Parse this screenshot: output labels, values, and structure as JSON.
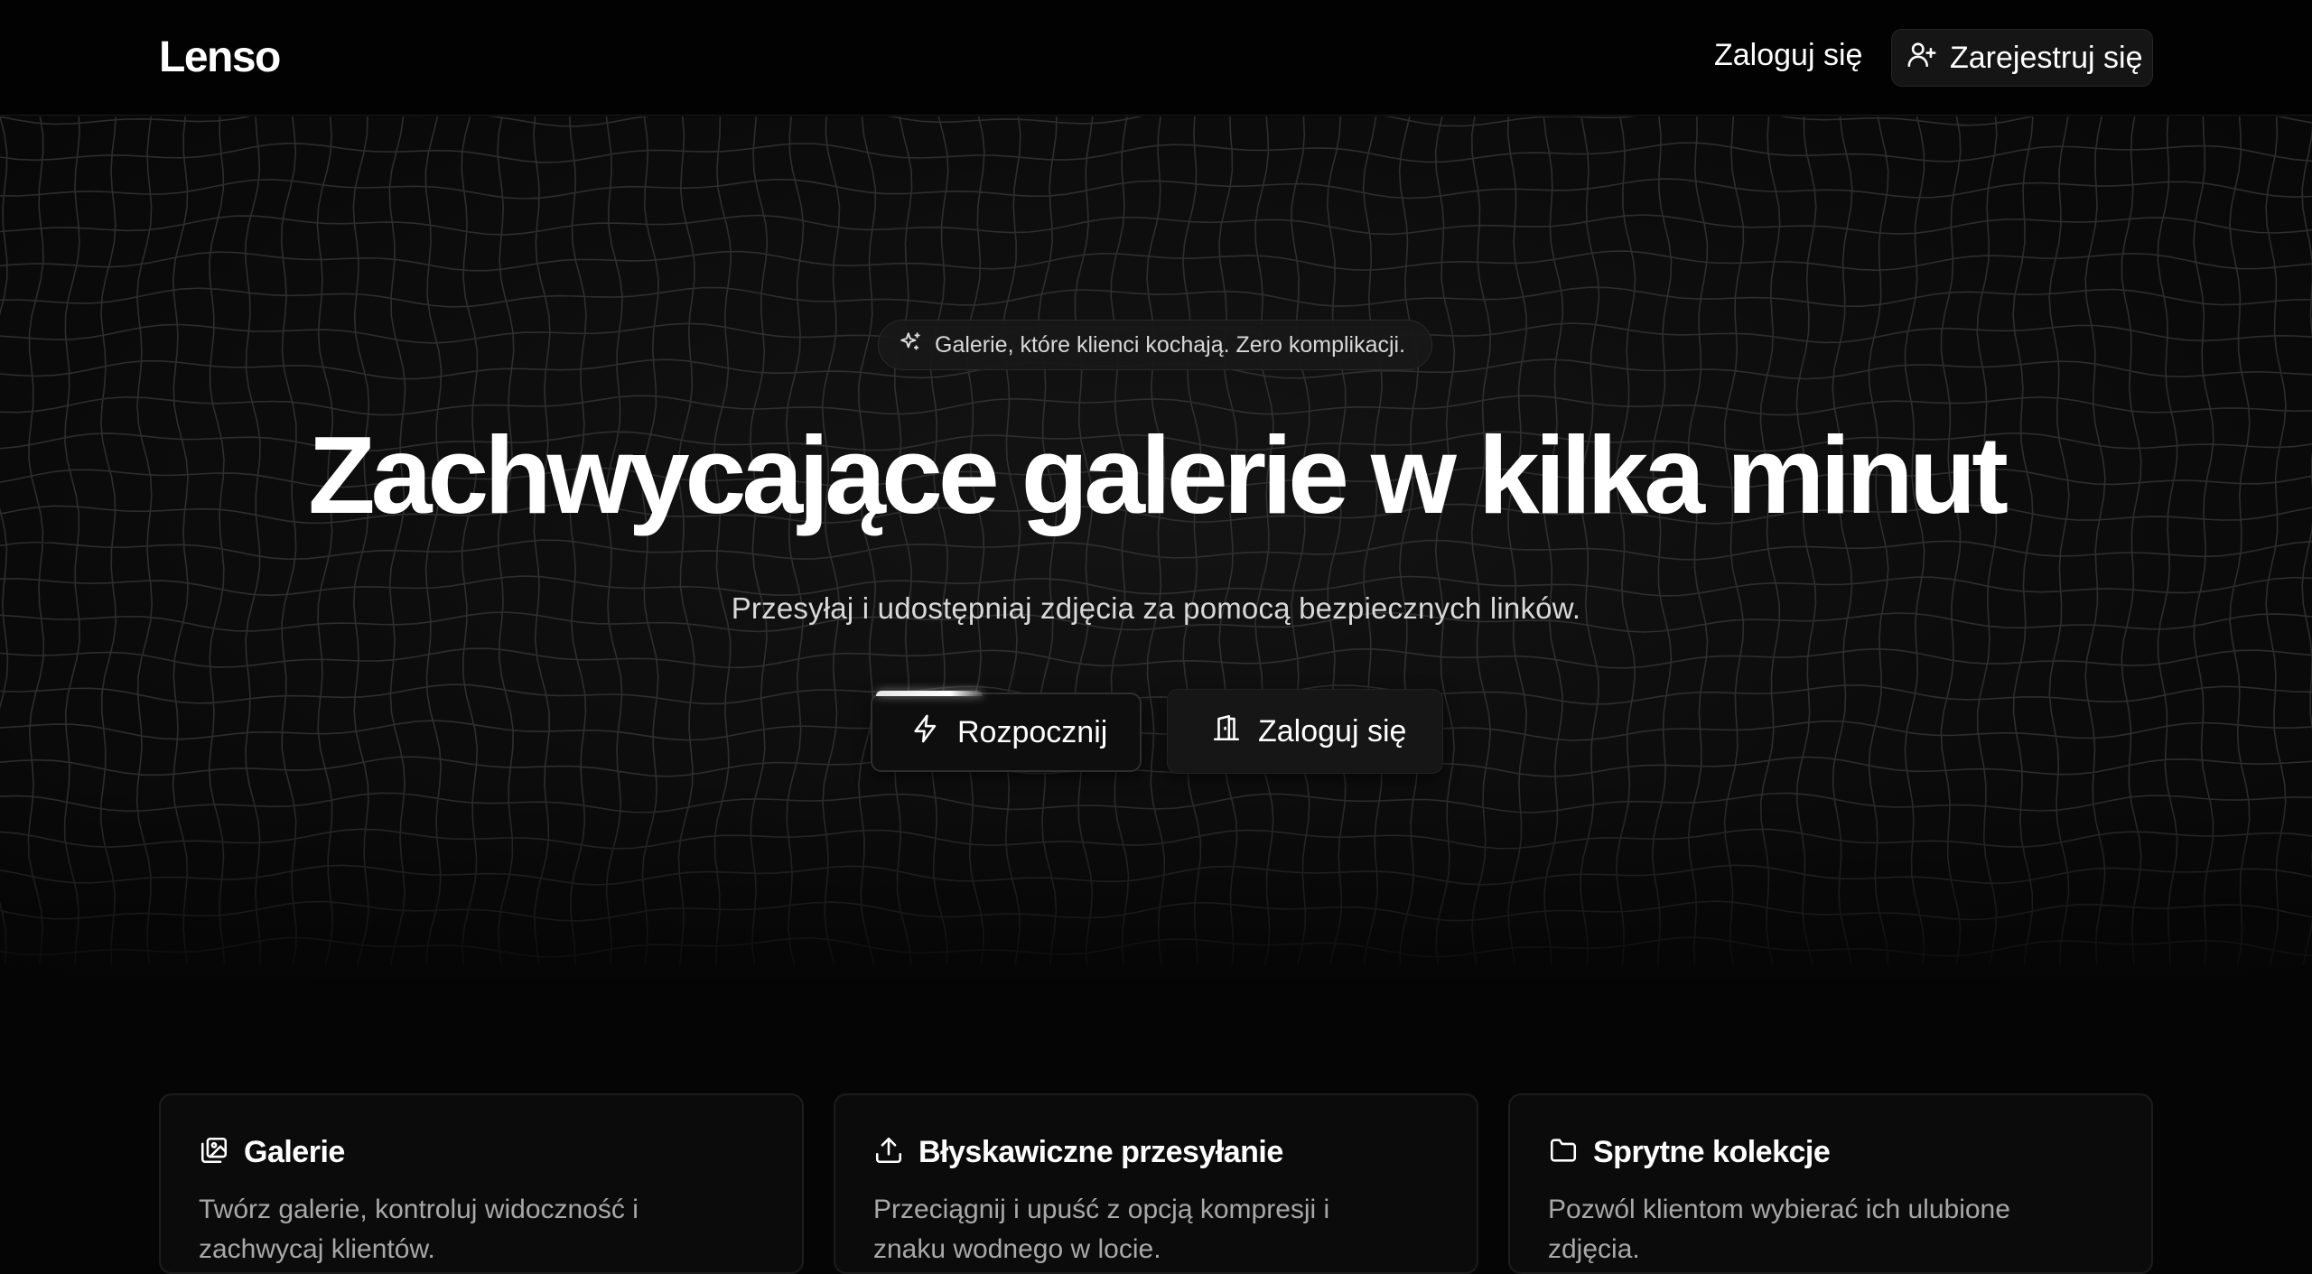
{
  "header": {
    "logo": "Lenso",
    "login_label": "Zaloguj się",
    "register_label": "Zarejestruj się"
  },
  "hero": {
    "badge_text": "Galerie, które klienci kochają. Zero komplikacji.",
    "title": "Zachwycające galerie w kilka minut",
    "subtitle": "Przesyłaj i udostępniaj zdjęcia za pomocą bezpiecznych linków.",
    "start_label": "Rozpocznij",
    "login_label": "Zaloguj się"
  },
  "features": [
    {
      "title": "Galerie",
      "description": "Twórz galerie, kontroluj widoczność i zachwycaj klientów.",
      "icon": "gallery-icon"
    },
    {
      "title": "Błyskawiczne przesyłanie",
      "description": "Przeciągnij i upuść z opcją kompresji i znaku wodnego w locie.",
      "icon": "upload-icon"
    },
    {
      "title": "Sprytne kolekcje",
      "description": "Pozwól klientom wybierać ich ulubione zdjęcia.",
      "icon": "folder-icon"
    }
  ],
  "colors": {
    "background": "#050505",
    "text": "#ffffff",
    "muted": "#a8a8a8"
  }
}
